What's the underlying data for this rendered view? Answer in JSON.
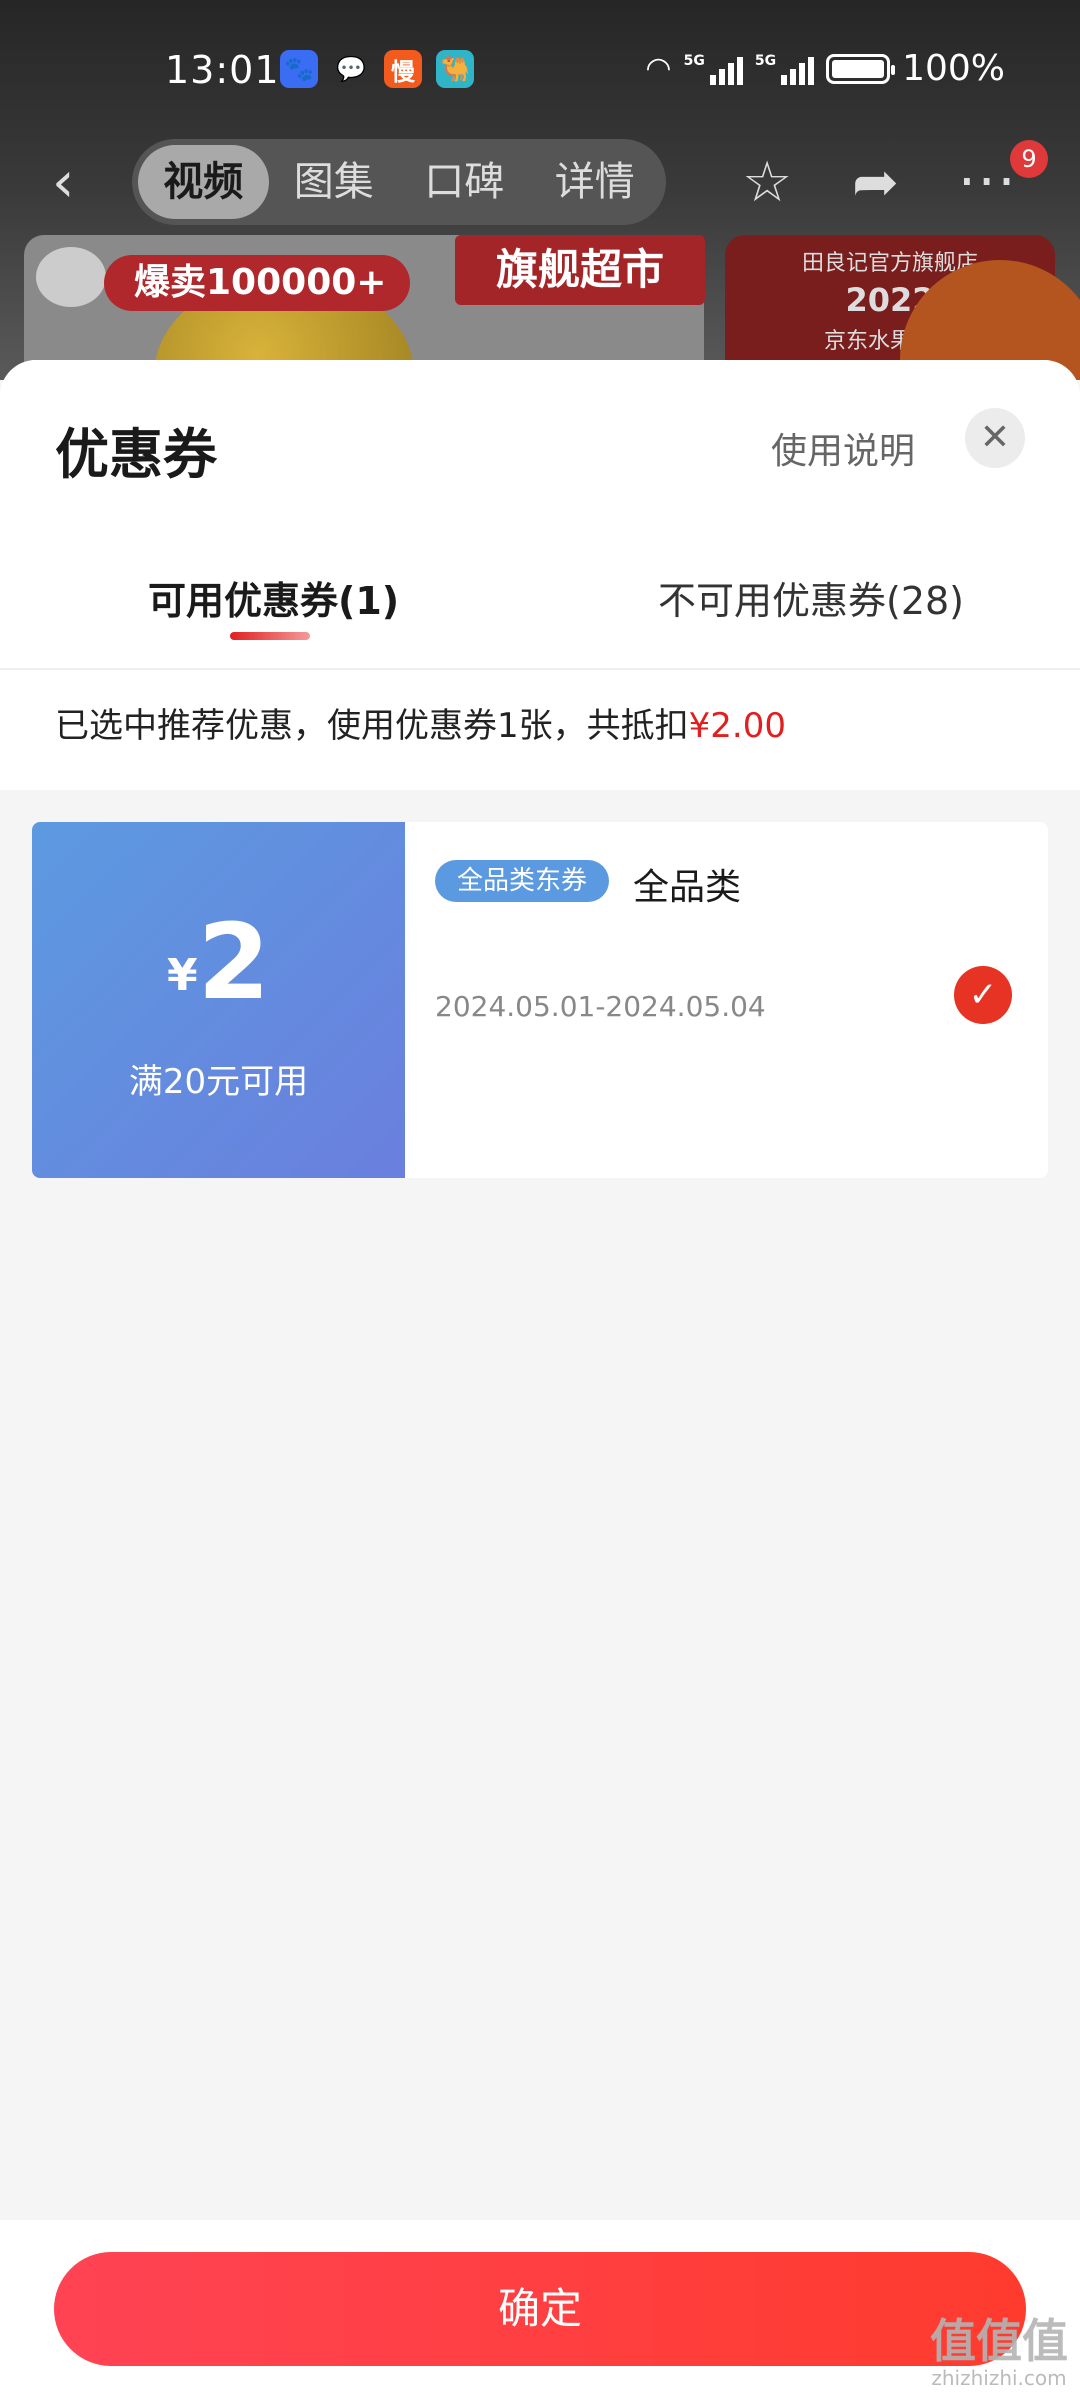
{
  "status_bar": {
    "time": "13:01",
    "apps": [
      {
        "icon": "baidu-paw-icon",
        "glyph": "🐾",
        "color": "#3a6cf4"
      },
      {
        "icon": "wechat-icon",
        "glyph": "💬",
        "color": "#4a4a4a"
      },
      {
        "icon": "app-man-icon",
        "glyph": "慢",
        "color": "#f25a1e"
      },
      {
        "icon": "app-camel-icon",
        "glyph": "🐫",
        "color": "#2fb4c8"
      }
    ],
    "network_1": "5G",
    "network_2": "5G",
    "battery": "100%"
  },
  "nav": {
    "tabs": [
      "视频",
      "图集",
      "口碑",
      "详情"
    ],
    "active_tab": "视频",
    "badge_count": "9"
  },
  "banner": {
    "sold": "爆卖100000+",
    "store_tag": "旗舰超市",
    "award_line1": "田良记官方旗舰店",
    "award_year": "2022",
    "award_line2": "京东水果类目"
  },
  "sheet": {
    "title": "优惠券",
    "help_link": "使用说明",
    "tabs": {
      "available": "可用优惠券(1)",
      "unavailable": "不可用优惠券(28)"
    },
    "summary_text": "已选中推荐优惠，使用优惠券1张，共抵扣",
    "summary_amount": "¥2.00"
  },
  "coupons": [
    {
      "currency": "¥",
      "amount": "2",
      "condition": "满20元可用",
      "tag": "全品类东券",
      "name": "全品类",
      "validity": "2024.05.01-2024.05.04",
      "selected": true
    }
  ],
  "footer": {
    "confirm_label": "确定",
    "watermark_big": "值值值",
    "watermark_small": "zhizhizhi.com"
  },
  "colors": {
    "accent_red": "#e0201e",
    "coupon_blue": "#5c9ae0",
    "button_red": "#ff3b2e"
  }
}
